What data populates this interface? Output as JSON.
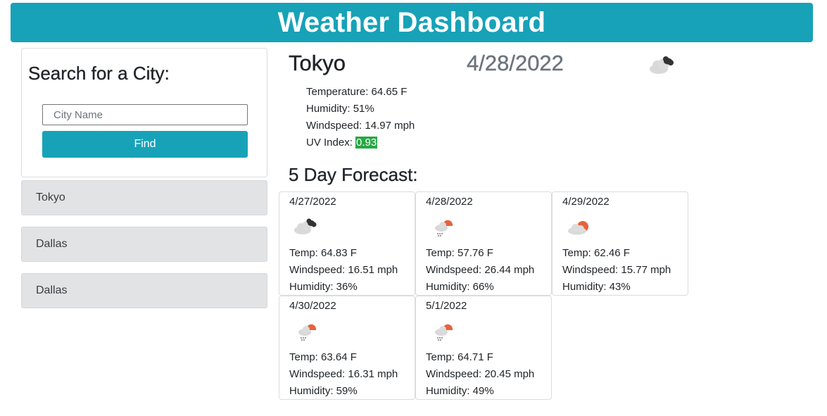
{
  "header": {
    "title": "Weather Dashboard"
  },
  "search": {
    "heading": "Search for a City:",
    "placeholder": "City Name",
    "value": "",
    "button_label": "Find"
  },
  "history": [
    "Tokyo",
    "Dallas",
    "Dallas"
  ],
  "current": {
    "city": "Tokyo",
    "date": "4/28/2022",
    "icon": "clouds-icon",
    "temperature_label": "Temperature: ",
    "temperature": "64.65 F",
    "humidity_label": "Humidity: ",
    "humidity": "51%",
    "windspeed_label": "Windspeed: ",
    "windspeed": "14.97 mph",
    "uv_label": "UV Index: ",
    "uv_index": "0.93",
    "uv_color": "#28a745"
  },
  "forecast": {
    "title": "5 Day Forecast:",
    "days": [
      {
        "date": "4/27/2022",
        "icon": "clouds-icon",
        "temp": "Temp: 64.83 F",
        "wind": "Windspeed: 16.51 mph",
        "humidity": "Humidity: 36%"
      },
      {
        "date": "4/28/2022",
        "icon": "rain-icon",
        "temp": "Temp: 57.76 F",
        "wind": "Windspeed: 26.44 mph",
        "humidity": "Humidity: 66%"
      },
      {
        "date": "4/29/2022",
        "icon": "partly-cloudy-icon",
        "temp": "Temp: 62.46 F",
        "wind": "Windspeed: 15.77 mph",
        "humidity": "Humidity: 43%"
      },
      {
        "date": "4/30/2022",
        "icon": "rain-icon",
        "temp": "Temp: 63.64 F",
        "wind": "Windspeed: 16.31 mph",
        "humidity": "Humidity: 59%"
      },
      {
        "date": "5/1/2022",
        "icon": "rain-icon",
        "temp": "Temp: 64.71 F",
        "wind": "Windspeed: 20.45 mph",
        "humidity": "Humidity: 49%"
      }
    ]
  },
  "colors": {
    "accent": "#17a2b8",
    "history_bg": "#e2e3e5",
    "sun": "#e8613c",
    "cloud": "#d9d9d9",
    "dark_cloud": "#333333"
  }
}
